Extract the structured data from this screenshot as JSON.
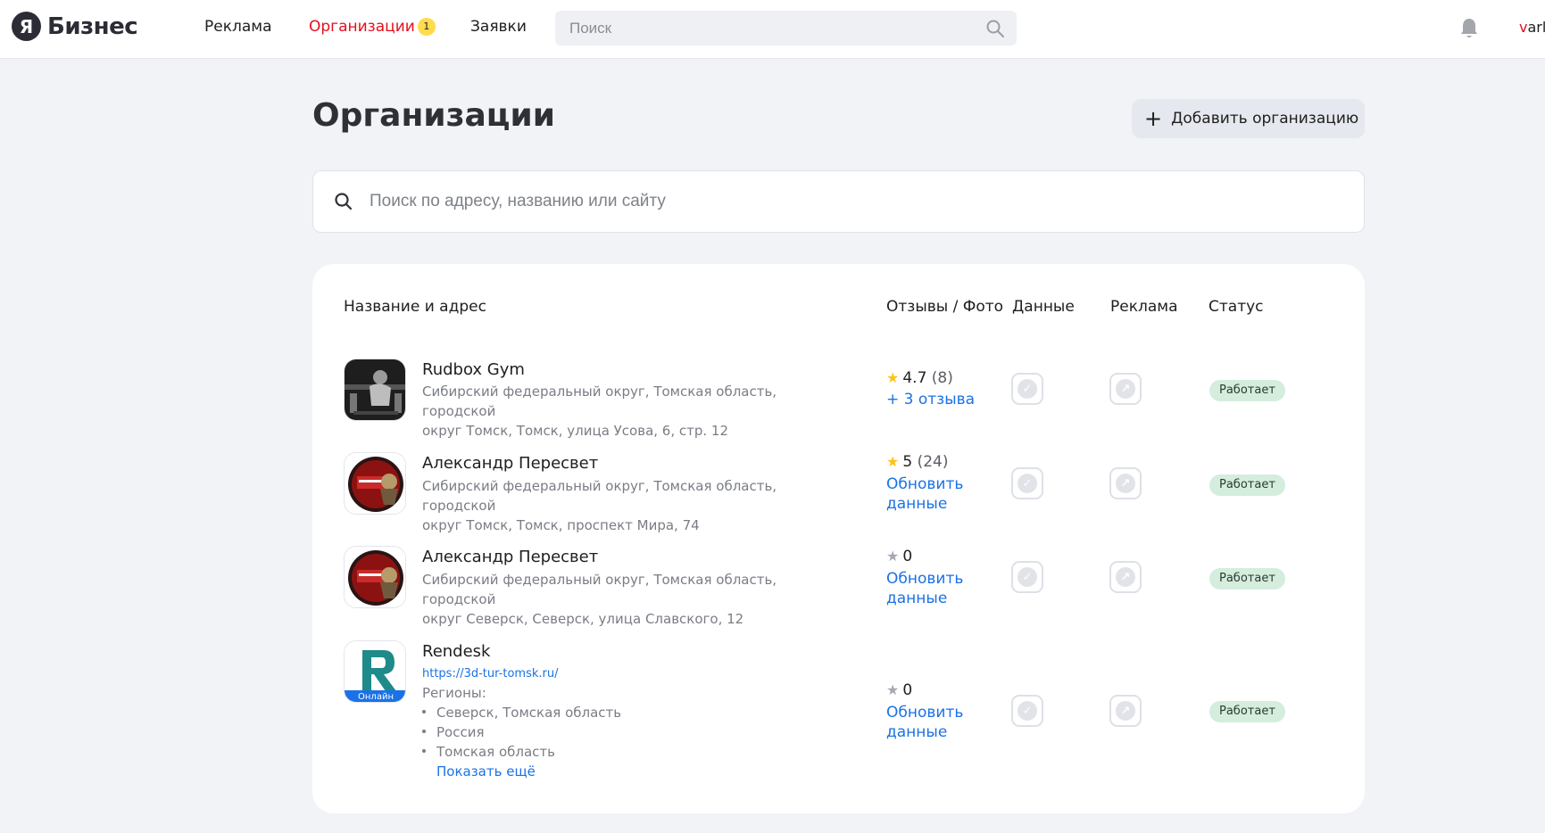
{
  "header": {
    "logo_letter": "Я",
    "logo_text": "Бизнес",
    "nav": [
      {
        "label": "Реклама",
        "active": false
      },
      {
        "label": "Организации",
        "active": true,
        "badge": "1"
      },
      {
        "label": "Заявки",
        "active": false
      }
    ],
    "search_placeholder": "Поиск",
    "user_login_first": "v",
    "user_login_rest": "arla"
  },
  "page": {
    "title": "Организации",
    "add_button_label": "Добавить организацию",
    "search_placeholder": "Поиск по адресу, названию или сайту"
  },
  "table": {
    "columns": [
      "Название и адрес",
      "Отзывы / Фото",
      "Данные",
      "Реклама",
      "Статус"
    ],
    "rows": [
      {
        "name": "Rudbox Gym",
        "address_line1": "Сибирский федеральный округ, Томская область, городской",
        "address_line2": "округ Томск, Томск, улица Усова, 6, стр. 12",
        "rating_value": "4.7",
        "rating_count": "(8)",
        "star": "gold",
        "action_line1": "+ 3 отзыва",
        "action_line2": "",
        "status": "Работает"
      },
      {
        "name": "Александр Пересвет",
        "address_line1": "Сибирский федеральный округ, Томская область, городской",
        "address_line2": "округ Томск, Томск, проспект Мира, 74",
        "rating_value": "5",
        "rating_count": "(24)",
        "star": "gold",
        "action_line1": "Обновить",
        "action_line2": "данные",
        "status": "Работает"
      },
      {
        "name": "Александр Пересвет",
        "address_line1": "Сибирский федеральный округ, Томская область, городской",
        "address_line2": "округ Северск, Северск, улица Славского, 12",
        "rating_value": "0",
        "rating_count": "",
        "star": "grey",
        "action_line1": "Обновить",
        "action_line2": "данные",
        "status": "Работает"
      },
      {
        "name": "Rendesk",
        "website": "https://3d-tur-tomsk.ru/",
        "avatar_letter": "R",
        "avatar_tag": "Онлайн",
        "regions_label": "Регионы:",
        "regions": [
          "Северск, Томская область",
          "Россия",
          "Томская область"
        ],
        "show_more": "Показать ещё",
        "rating_value": "0",
        "rating_count": "",
        "star": "grey",
        "action_line1": "Обновить",
        "action_line2": "данные",
        "status": "Работает"
      }
    ]
  },
  "colors": {
    "accent_red": "#e3101d",
    "link_blue": "#1a72e6",
    "status_green_bg": "#d4eddd",
    "star_gold": "#fcc419",
    "page_bg": "#f2f3f7"
  }
}
